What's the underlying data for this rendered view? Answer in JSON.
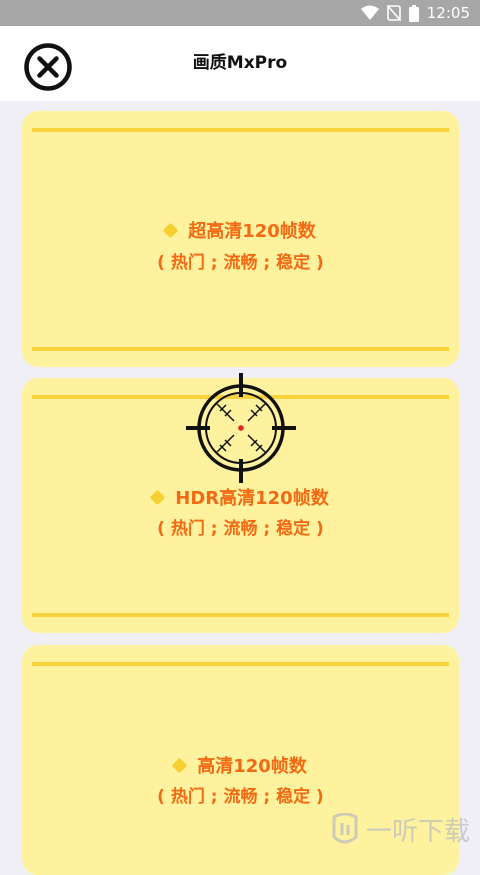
{
  "status_bar": {
    "time": "12:05",
    "icons": [
      "wifi-icon",
      "signal-off-icon",
      "battery-icon"
    ]
  },
  "header": {
    "title": "画质MxPro",
    "close_icon": "close-circle-icon"
  },
  "cards": [
    {
      "name": "超高清120帧数",
      "tags": "( 热门 ; 流畅 ; 稳定 )"
    },
    {
      "name": "HDR高清120帧数",
      "tags": "( 热门 ; 流畅 ; 稳定 )"
    },
    {
      "name": "高清120帧数",
      "tags": "( 热门 ; 流畅 ; 稳定 )"
    }
  ],
  "watermark": {
    "text": "一听下载"
  },
  "colors": {
    "card_bg": "#fff29e",
    "accent_bar": "#f8d23a",
    "text_orange": "#f26b14",
    "status_bar": "#a7a7a7"
  }
}
